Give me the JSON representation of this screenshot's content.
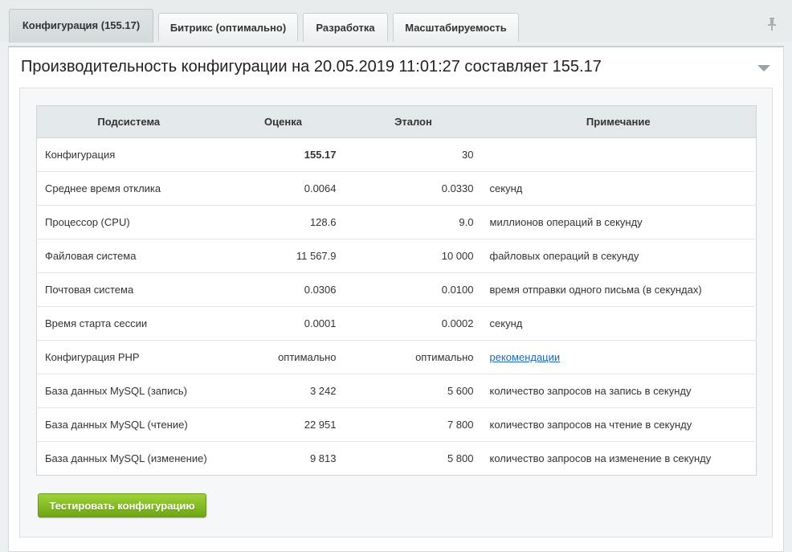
{
  "tabs": [
    {
      "label": "Конфигурация (155.17)",
      "active": true
    },
    {
      "label": "Битрикс (оптимально)",
      "active": false
    },
    {
      "label": "Разработка",
      "active": false
    },
    {
      "label": "Масштабируемость",
      "active": false
    }
  ],
  "panel": {
    "title": "Производительность конфигурации на 20.05.2019 11:01:27 составляет 155.17"
  },
  "table": {
    "headers": [
      "Подсистема",
      "Оценка",
      "Эталон",
      "Примечание"
    ],
    "rows": [
      {
        "subsystem": "Конфигурация",
        "score": "155.17",
        "reference": "30",
        "note": ""
      },
      {
        "subsystem": "Среднее время отклика",
        "score": "0.0064",
        "reference": "0.0330",
        "note": "секунд"
      },
      {
        "subsystem": "Процессор (CPU)",
        "score": "128.6",
        "reference": "9.0",
        "note": "миллионов операций в секунду"
      },
      {
        "subsystem": "Файловая система",
        "score": "11 567.9",
        "reference": "10 000",
        "note": "файловых операций в секунду"
      },
      {
        "subsystem": "Почтовая система",
        "score": "0.0306",
        "reference": "0.0100",
        "note": "время отправки одного письма (в секундах)"
      },
      {
        "subsystem": "Время старта сессии",
        "score": "0.0001",
        "reference": "0.0002",
        "note": "секунд"
      },
      {
        "subsystem": "Конфигурация PHP",
        "score": "оптимально",
        "reference": "оптимально",
        "note": "рекомендации"
      },
      {
        "subsystem": "База данных MySQL (запись)",
        "score": "3 242",
        "reference": "5 600",
        "note": "количество запросов на запись в секунду"
      },
      {
        "subsystem": "База данных MySQL (чтение)",
        "score": "22 951",
        "reference": "7 800",
        "note": "количество запросов на чтение в секунду"
      },
      {
        "subsystem": "База данных MySQL (изменение)",
        "score": "9 813",
        "reference": "5 800",
        "note": "количество запросов на изменение в секунду"
      }
    ]
  },
  "test_button": {
    "label": "Тестировать конфигурацию"
  },
  "icons": {
    "pin": "pin-icon",
    "collapse": "collapse-arrow-icon"
  },
  "colors": {
    "accent_button": "#7db51e",
    "link": "#2067b0"
  }
}
